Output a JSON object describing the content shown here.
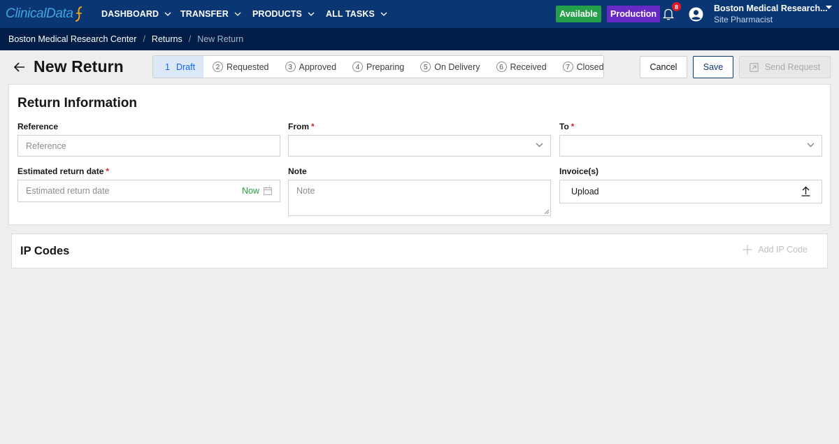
{
  "brand": {
    "logo_text": "ClinicalData"
  },
  "nav": {
    "items": [
      {
        "label": "DASHBOARD"
      },
      {
        "label": "TRANSFER"
      },
      {
        "label": "PRODUCTS"
      },
      {
        "label": "ALL TASKS"
      }
    ],
    "status_badge": "Available",
    "env_badge": "Production",
    "notification_count": "8",
    "user_name": "Boston Medical Research...",
    "user_role": "Site Pharmacist"
  },
  "breadcrumb": [
    "Boston Medical Research Center",
    "Returns",
    "New Return"
  ],
  "page": {
    "title": "New Return"
  },
  "steps": [
    {
      "num": "1",
      "label": "Draft"
    },
    {
      "num": "2",
      "label": "Requested"
    },
    {
      "num": "3",
      "label": "Approved"
    },
    {
      "num": "4",
      "label": "Preparing"
    },
    {
      "num": "5",
      "label": "On Delivery"
    },
    {
      "num": "6",
      "label": "Received"
    },
    {
      "num": "7",
      "label": "Closed"
    }
  ],
  "actions": {
    "cancel": "Cancel",
    "save": "Save",
    "send": "Send Request"
  },
  "return_info": {
    "title": "Return Information",
    "reference_label": "Reference",
    "reference_placeholder": "Reference",
    "from_label": "From",
    "to_label": "To",
    "required_mark": "*",
    "date_label": "Estimated return date",
    "date_placeholder": "Estimated return date",
    "now_label": "Now",
    "note_label": "Note",
    "note_placeholder": "Note",
    "invoice_label": "Invoice(s)",
    "upload_label": "Upload"
  },
  "ip_codes": {
    "title": "IP Codes",
    "add_label": "Add IP Code"
  },
  "colors": {
    "nav_bg": "#0a3673",
    "breadcrumb_bg": "#001d48",
    "available": "#24a148",
    "production": "#6929c4",
    "accent": "#0f62fe",
    "required": "#da1e28"
  }
}
